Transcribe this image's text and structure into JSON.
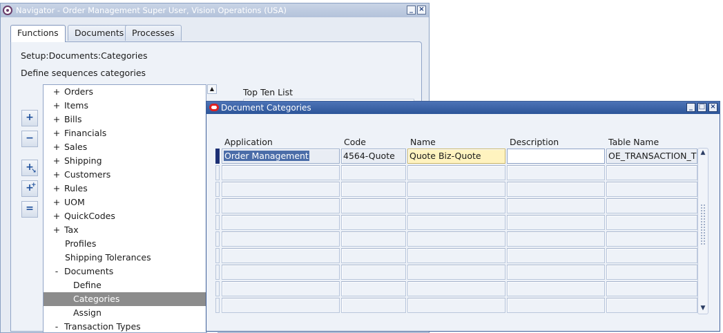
{
  "navigator": {
    "title": "Navigator - Order Management Super User, Vision Operations (USA)",
    "tabs": [
      "Functions",
      "Documents",
      "Processes"
    ],
    "path": "Setup:Documents:Categories",
    "description": "Define sequences categories",
    "tree": [
      {
        "prefix": "+",
        "label": "Orders"
      },
      {
        "prefix": "+",
        "label": "Items"
      },
      {
        "prefix": "+",
        "label": "Bills"
      },
      {
        "prefix": "+",
        "label": "Financials"
      },
      {
        "prefix": "+",
        "label": "Sales"
      },
      {
        "prefix": "+",
        "label": "Shipping"
      },
      {
        "prefix": "+",
        "label": "Customers"
      },
      {
        "prefix": "+",
        "label": "Rules"
      },
      {
        "prefix": "+",
        "label": "UOM"
      },
      {
        "prefix": "+",
        "label": "QuickCodes"
      },
      {
        "prefix": "+",
        "label": "Tax"
      },
      {
        "prefix": "",
        "label": "Profiles"
      },
      {
        "prefix": "",
        "label": "Shipping Tolerances"
      },
      {
        "prefix": "-",
        "label": "Documents"
      },
      {
        "prefix": "",
        "label": "Define"
      },
      {
        "prefix": "",
        "label": "Categories"
      },
      {
        "prefix": "",
        "label": "Assign"
      },
      {
        "prefix": "-",
        "label": "Transaction Types"
      }
    ],
    "top_ten_label": "Top Ten List"
  },
  "doc_categories": {
    "title": "Document Categories",
    "columns": {
      "application": "Application",
      "code": "Code",
      "name": "Name",
      "description": "Description",
      "table_name": "Table Name"
    },
    "row1": {
      "application": "Order Management",
      "code": "4564-Quote",
      "name": "Quote Biz-Quote",
      "description": "",
      "table_name": "OE_TRANSACTION_T"
    },
    "empty_rows": 9
  }
}
